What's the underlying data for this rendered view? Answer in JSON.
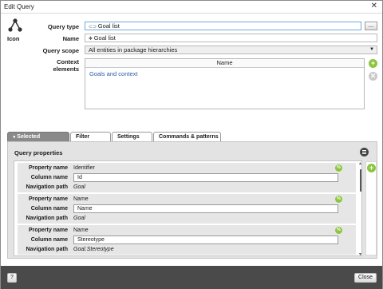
{
  "window": {
    "title": "Edit Query",
    "close_glyph": "✕"
  },
  "icon_label": "Icon",
  "form": {
    "query_type_label": "Query type",
    "query_type_value": "Goal list",
    "browse_label": "...",
    "name_label": "Name",
    "name_value": "Goal list",
    "scope_label": "Query scope",
    "scope_value": "All entities in package hierarchies",
    "context_label": "Context elements",
    "context_column": "Name",
    "context_rows": [
      "Goals and context"
    ]
  },
  "tabs": [
    "Selected Properties",
    "Filter",
    "Settings",
    "Commands & patterns"
  ],
  "panel_title": "Query properties",
  "property_labels": {
    "property": "Property name",
    "column": "Column name",
    "path": "Navigation path"
  },
  "properties": [
    {
      "property": "Identifier",
      "column": "Id",
      "path": "Goal"
    },
    {
      "property": "Name",
      "column": "Name",
      "path": "Goal"
    },
    {
      "property": "Name",
      "column": "Stereotype",
      "path": "Goal.Stereotype"
    }
  ],
  "badge_text": "%",
  "footer": {
    "help": "?",
    "close": "Close"
  },
  "colors": {
    "accent_green": "#8cc63f",
    "footer_bg": "#4a4a4a",
    "link_blue": "#2a5ca8"
  },
  "icons": [
    "close-icon",
    "query-icon",
    "add-icon",
    "remove-icon",
    "menu-icon",
    "dropdown-arrow-icon",
    "scroll-up-icon",
    "scroll-down-icon"
  ]
}
